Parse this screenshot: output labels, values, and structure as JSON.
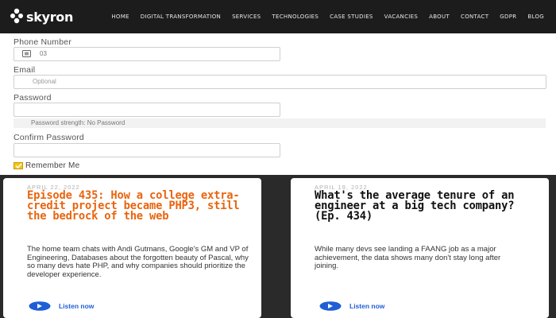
{
  "brand": {
    "name": "skyron"
  },
  "nav": {
    "items": [
      {
        "label": "HOME"
      },
      {
        "label": "DIGITAL TRANSFORMATION"
      },
      {
        "label": "SERVICES"
      },
      {
        "label": "TECHNOLOGIES"
      },
      {
        "label": "CASE STUDIES"
      },
      {
        "label": "VACANCIES"
      },
      {
        "label": "ABOUT"
      },
      {
        "label": "CONTACT"
      },
      {
        "label": "GDPR"
      },
      {
        "label": "BLOG"
      }
    ]
  },
  "form": {
    "phone": {
      "label": "Phone Number",
      "value": "03",
      "icon": "phone-icon"
    },
    "email": {
      "label": "Email",
      "placeholder": "Optional"
    },
    "password": {
      "label": "Password",
      "strength": "Password strength: No Password"
    },
    "confirm": {
      "label": "Confirm Password"
    },
    "remember": {
      "label": "Remember Me",
      "checked": true
    }
  },
  "cards": [
    {
      "date": "APRIL 22, 2022",
      "title": "Episode 435: How a college extra-credit project became PHP3, still the bedrock of the web",
      "title_color": "#e8650f",
      "description": "The home team chats with Andi Gutmans, Google's GM and VP of Engineering, Databases about the forgotten beauty of Pascal, why so many devs hate PHP, and why companies should prioritize the developer experience.",
      "cta": "Listen now"
    },
    {
      "date": "APRIL 19, 2022",
      "title": "What's the average tenure of an engineer at a big tech company? (Ep. 434)",
      "title_color": "#111111",
      "description": "While many devs see landing a FAANG job as a major achievement, the data shows many don't stay long after joining.",
      "cta": "Listen now"
    }
  ],
  "colors": {
    "nav_bg": "#1c1c1c",
    "page_bg": "#2a2a2a",
    "accent_orange": "#e8650f",
    "link_blue": "#1f5fd6",
    "checkbox_yellow": "#f5c518"
  }
}
